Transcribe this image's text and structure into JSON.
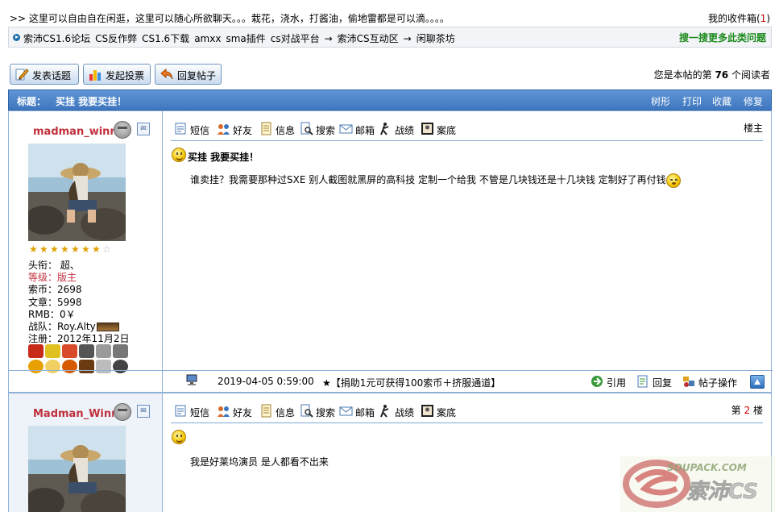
{
  "top": {
    "desc": ">> 这里可以自由自在闲逛，这里可以随心所欲聊天。。。栽花，浇水，打酱油，偷地雷都是可以滴。。。。",
    "inbox_label": "我的收件箱",
    "inbox_open": "(",
    "inbox_count": "1",
    "inbox_close": ")"
  },
  "breadcrumb": {
    "items": [
      "索沛CS1.6论坛",
      "CS反作弊",
      "CS1.6下载",
      "amxx",
      "sma插件",
      "cs对战平台",
      "→",
      "索沛CS互动区",
      "→",
      "闲聊茶坊"
    ],
    "more": "搜一搜更多此类问题"
  },
  "buttons": {
    "new_topic": "发表话题",
    "new_poll": "发起投票",
    "reply": "回复帖子"
  },
  "readcount": {
    "prefix": "您是本帖的第",
    "count": "76",
    "suffix": "个阅读者"
  },
  "thread": {
    "title_label": "标题：",
    "title": "买挂 我要买挂！",
    "actions": [
      "树形",
      "打印",
      "收藏",
      "修复"
    ]
  },
  "toolbar": [
    "短信",
    "好友",
    "信息",
    "搜索",
    "邮箱",
    "战绩",
    "案底"
  ],
  "posts": [
    {
      "user": {
        "name": "madman_winner",
        "stars": 7,
        "stars_max": 8,
        "title_label": "头衔：",
        "title": "超、",
        "level_label": "等级：",
        "level": "版主",
        "coins_label": "索币：",
        "coins": "2698",
        "articles_label": "文章：",
        "articles": "5998",
        "rmb_label": "RMB：",
        "rmb": "0￥",
        "team_label": "战队：",
        "team": "Roy.Alty",
        "reg_label": "注册：",
        "reg": "2012年11月2日"
      },
      "floor_label": "楼主",
      "title": "买挂 我要买挂！",
      "body": "谁卖挂？我需要那种过SXE 别人截图就黑屏的高科技 定制一个给我 不管是几块钱还是十几块钱 定制好了再付钱",
      "date": "2019-04-05 0:59:00",
      "donate": "★【捐助1元可获得100索币＋挤服通道】",
      "footer_actions": [
        "引用",
        "回复",
        "帖子操作"
      ]
    },
    {
      "user": {
        "name": "Madman_Winner"
      },
      "floor_prefix": "第",
      "floor_num": "2",
      "floor_suffix": "楼",
      "body": "我是好莱坞演员 是人都看不出来"
    }
  ],
  "watermark": {
    "url": "SOUPACK.COM",
    "brand": "索沛CS"
  },
  "colors": {
    "title_bar": "#4a82c8",
    "username": "#c0303c",
    "search_more": "#1b8a1b",
    "border": "#8fb1d8"
  }
}
